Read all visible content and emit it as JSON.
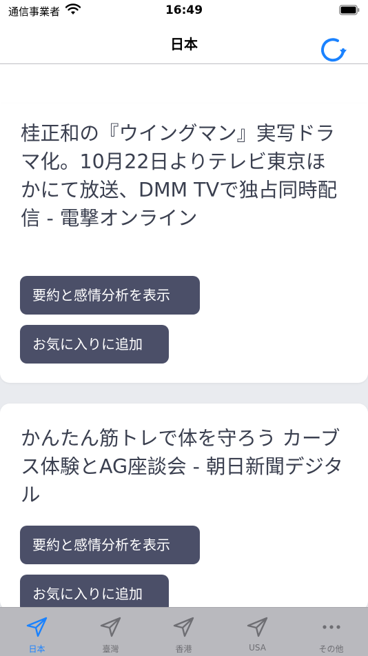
{
  "status_bar": {
    "carrier": "通信事業者",
    "time": "16:49"
  },
  "nav": {
    "title": "日本",
    "refresh_icon": "refresh-icon"
  },
  "articles": [
    {
      "title": "桂正和の『ウイングマン』実写ドラマ化。10月22日よりテレビ東京ほかにて放送、DMM TVで独占同時配信 - 電撃オンライン",
      "summary_button": "要約と感情分析を表示",
      "favorite_button": "お気に入りに追加"
    },
    {
      "title": "かんたん筋トレで体を守ろう カーブス体験とAG座談会 - 朝日新聞デジタル",
      "summary_button": "要約と感情分析を表示",
      "favorite_button": "お気に入りに追加"
    }
  ],
  "tabs": [
    {
      "label": "日本",
      "icon": "send-icon",
      "active": true
    },
    {
      "label": "臺灣",
      "icon": "send-icon",
      "active": false
    },
    {
      "label": "香港",
      "icon": "send-icon",
      "active": false
    },
    {
      "label": "USA",
      "icon": "send-icon",
      "active": false
    },
    {
      "label": "その他",
      "icon": "more-icon",
      "active": false
    }
  ],
  "colors": {
    "accent": "#1a82ff",
    "button_bg": "#4b4f68",
    "title_text": "#3a3f4f",
    "tab_bar_bg": "#b9b9be"
  }
}
